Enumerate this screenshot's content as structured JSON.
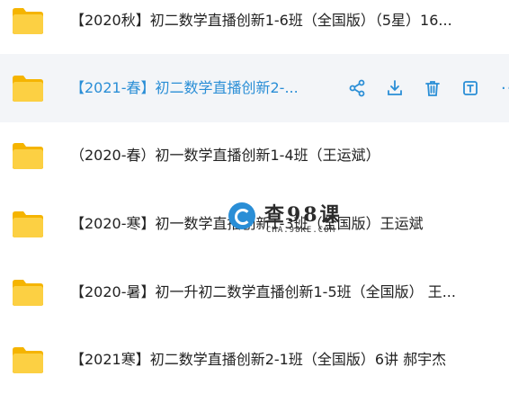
{
  "files": [
    {
      "name": "【2020秋】初二数学直播创新1-6班（全国版）（5星）16..."
    },
    {
      "name": "【2021-春】初二数学直播创新2-..."
    },
    {
      "name": "（2020-春）初一数学直播创新1-4班（王运斌）"
    },
    {
      "name": "【2020-寒】初一数学直播创新1-3班（全国版）王运斌"
    },
    {
      "name": "【2020-暑】初一升初二数学直播创新1-5班（全国版） 王..."
    },
    {
      "name": "【2021寒】初二数学直播创新2-1班（全国版）6讲 郝宇杰"
    }
  ],
  "actions": {
    "share": "share-icon",
    "download": "download-icon",
    "delete": "trash-icon",
    "rename": "rename-icon",
    "more": "···"
  },
  "watermark": {
    "title": "查98课",
    "url": "CHA.98KE.COM"
  },
  "colors": {
    "accent": "#2a8ed6",
    "folder": "#f8c830",
    "hover_bg": "#f3f5f8"
  }
}
